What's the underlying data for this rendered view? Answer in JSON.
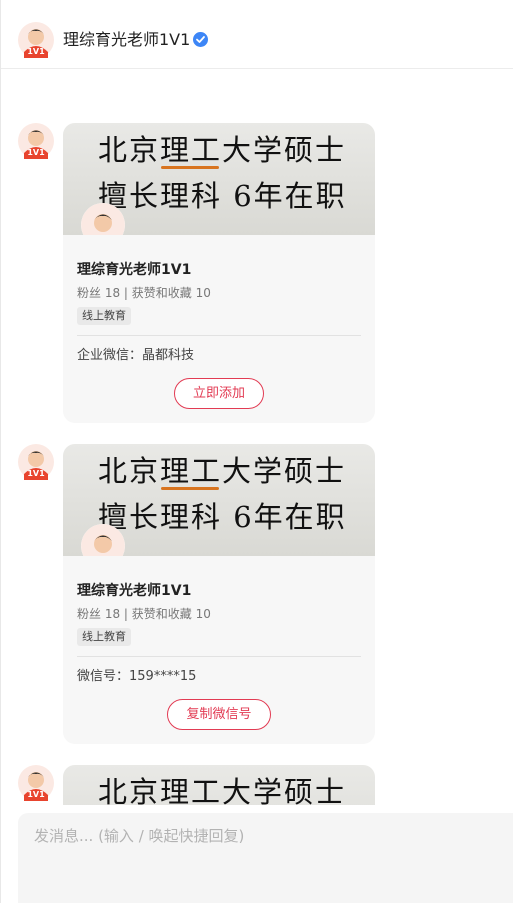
{
  "header": {
    "title": "理综育光老师1V1",
    "verified_icon": "verified-badge-icon",
    "avatar_text": "1V1"
  },
  "colors": {
    "accent": "#e23b53",
    "verified": "#3d86f6",
    "card_bg": "#f7f7f7"
  },
  "messages": [
    {
      "banner": {
        "line1": "北京理工大学硕士",
        "line2": "擅长理科 6年在职"
      },
      "name": "理综育光老师1V1",
      "stats": "粉丝 18 | 获赞和收藏 10",
      "tag": "线上教育",
      "info": "企业微信：晶都科技",
      "button": "立即添加"
    },
    {
      "banner": {
        "line1": "北京理工大学硕士",
        "line2": "擅长理科 6年在职"
      },
      "name": "理综育光老师1V1",
      "stats": "粉丝 18 | 获赞和收藏 10",
      "tag": "线上教育",
      "info": "微信号：159****15",
      "button": "复制微信号"
    },
    {
      "banner": {
        "line1": "北京理工大学硕士",
        "line2": ""
      }
    }
  ],
  "composer": {
    "placeholder": "发消息... (输入 / 唤起快捷回复)"
  }
}
